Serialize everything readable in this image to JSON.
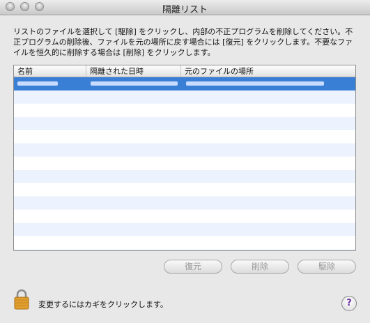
{
  "window": {
    "title": "隔離リスト"
  },
  "description": "リストのファイルを選択して [駆除] をクリックし、内部の不正プログラムを削除してください。不正プログラムの削除後、ファイルを元の場所に戻す場合には [復元] をクリックします。不要なファイルを恒久的に削除する場合は [削除] をクリックします。",
  "table": {
    "columns": [
      "名前",
      "隔離された日時",
      "元のファイルの場所"
    ]
  },
  "buttons": {
    "restore": "復元",
    "delete": "削除",
    "clean": "駆除"
  },
  "footer": {
    "lock_text": "変更するにはカギをクリックします。",
    "help": "?"
  }
}
